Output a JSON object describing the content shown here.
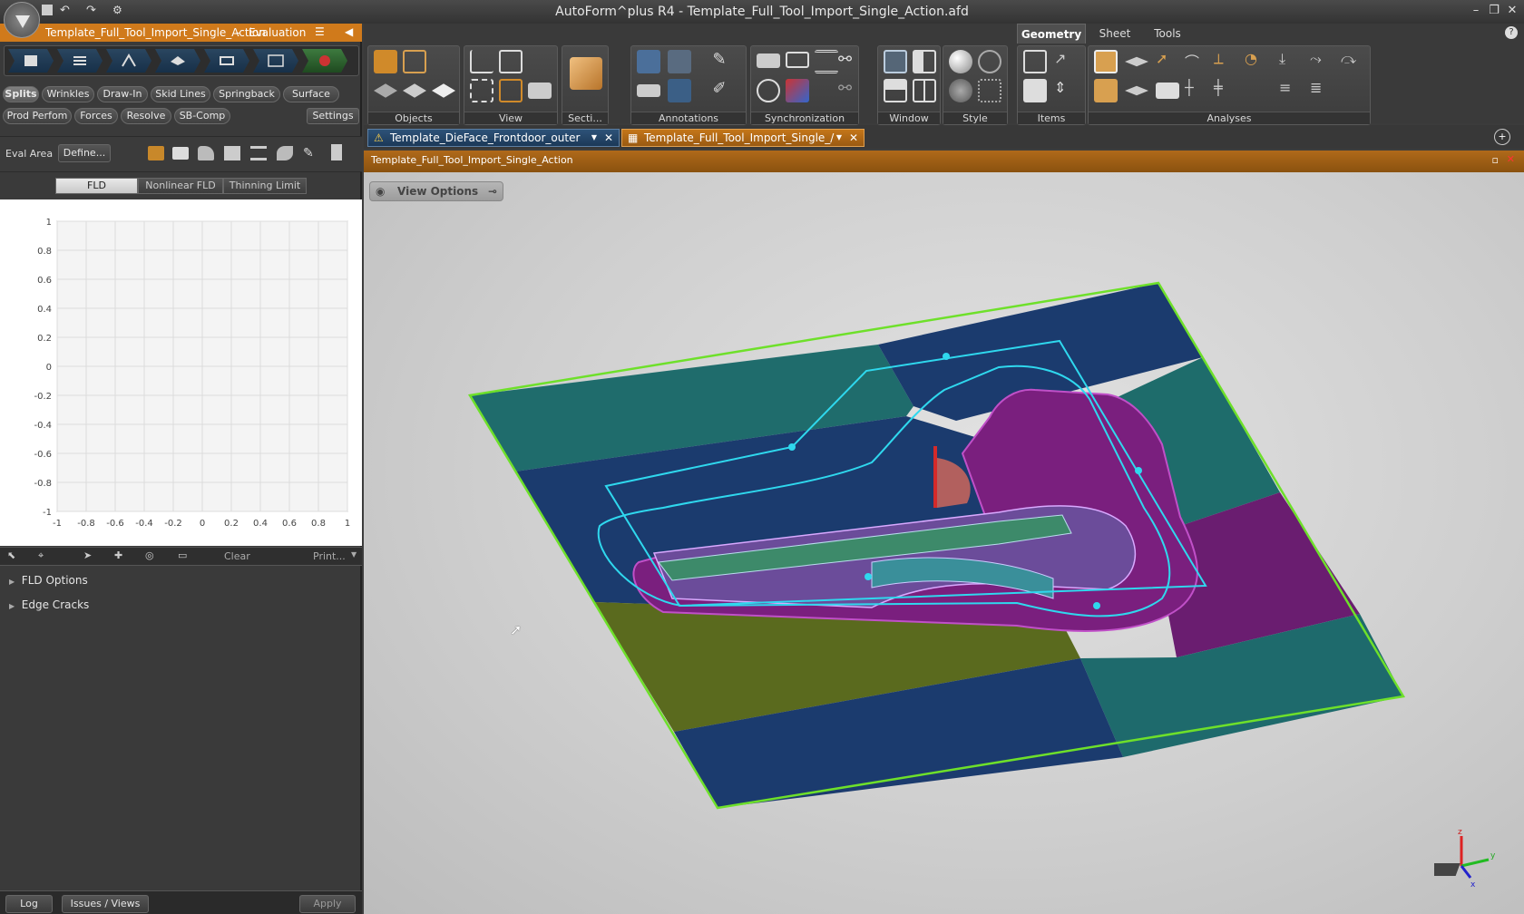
{
  "window": {
    "title": "AutoForm^plus R4 - Template_Full_Tool_Import_Single_Action.afd"
  },
  "project_bar": {
    "name": "Template_Full_Tool_Import_Single_Action",
    "separator": "-",
    "mode": "Evaluation"
  },
  "eval_tabs_row1": [
    "Splits",
    "Wrinkles",
    "Draw-In",
    "Skid Lines",
    "Springback",
    "Surface"
  ],
  "eval_tabs_row2": [
    "Prod Perfom",
    "Forces",
    "Resolve",
    "SB-Comp"
  ],
  "settings_label": "Settings",
  "eval_area": {
    "label": "Eval Area",
    "button": "Define..."
  },
  "fld_tabs": [
    "FLD",
    "Nonlinear FLD",
    "Thinning Limit"
  ],
  "fld_tabs_active": "FLD",
  "chart_data": {
    "type": "scatter",
    "title": "",
    "xlabel": "",
    "ylabel": "",
    "xlim": [
      -1,
      1
    ],
    "ylim": [
      -1,
      1
    ],
    "xticks": [
      "-1",
      "-0.8",
      "-0.6",
      "-0.4",
      "-0.2",
      "0",
      "0.2",
      "0.4",
      "0.6",
      "0.8",
      "1"
    ],
    "yticks": [
      "1",
      "0.8",
      "0.6",
      "0.4",
      "0.2",
      "0",
      "-0.2",
      "-0.4",
      "-0.6",
      "-0.8",
      "-1"
    ],
    "grid": true,
    "series": []
  },
  "fld_toolbar": {
    "clear": "Clear",
    "print": "Print..."
  },
  "sections": [
    "FLD Options",
    "Edge Cracks"
  ],
  "bottom_bar": {
    "log": "Log",
    "issues": "Issues / Views",
    "apply": "Apply"
  },
  "ribbon": {
    "tabs": [
      "Geometry",
      "Sheet",
      "Tools"
    ],
    "active_tab": "Geometry",
    "groups": [
      "Objects",
      "View",
      "Secti...",
      "Annotations",
      "Synchronization",
      "Window",
      "Style",
      "Items",
      "Analyses"
    ]
  },
  "doc_tabs": [
    {
      "label": "Template_DieFace_Frontdoor_outer"
    },
    {
      "label": "Template_Full_Tool_Import_Single_/"
    }
  ],
  "view_header": "Template_Full_Tool_Import_Single_Action",
  "view_options": "View Options",
  "triad": {
    "z": "z",
    "y": "y",
    "x": "x"
  },
  "colors": {
    "accent_orange": "#d07a1b",
    "sheet_teal": "#1e6b6b",
    "sheet_blue": "#1b3a6a",
    "sheet_purple": "#6a1d70",
    "sheet_olive": "#5a6b1e",
    "outline_green": "#6ee02a",
    "cyan": "#2fd8ee"
  }
}
